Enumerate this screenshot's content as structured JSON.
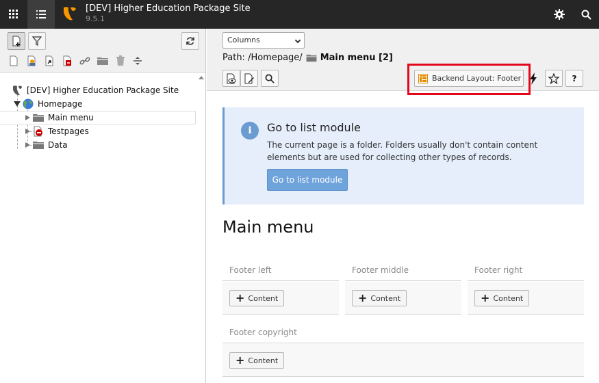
{
  "topbar": {
    "site_name": "[DEV] Higher Education Package Site",
    "version": "9.5.1",
    "brand_color": "#f49700"
  },
  "tree": {
    "root_label": "[DEV] Higher Education Package Site",
    "items": [
      {
        "label": "Homepage",
        "icon": "globe-icon"
      },
      {
        "label": "Main menu",
        "icon": "folder-icon"
      },
      {
        "label": "Testpages",
        "icon": "restricted-page-icon"
      },
      {
        "label": "Data",
        "icon": "folder-icon"
      }
    ]
  },
  "module": {
    "view_select": "Columns",
    "path_prefix": "Path: /Homepage/",
    "path_current": "Main menu [2]",
    "backend_layout_label": "Backend Layout: Footer",
    "help_label": "?"
  },
  "info": {
    "icon": "i",
    "title": "Go to list module",
    "text": "The current page is a folder. Folders usually don't contain content elements but are used for collecting other types of records.",
    "button": "Go to list module"
  },
  "page": {
    "title": "Main menu"
  },
  "columns": [
    {
      "name": "Footer left",
      "button": "Content"
    },
    {
      "name": "Footer middle",
      "button": "Content"
    },
    {
      "name": "Footer right",
      "button": "Content"
    },
    {
      "name": "Footer copyright",
      "button": "Content"
    }
  ]
}
